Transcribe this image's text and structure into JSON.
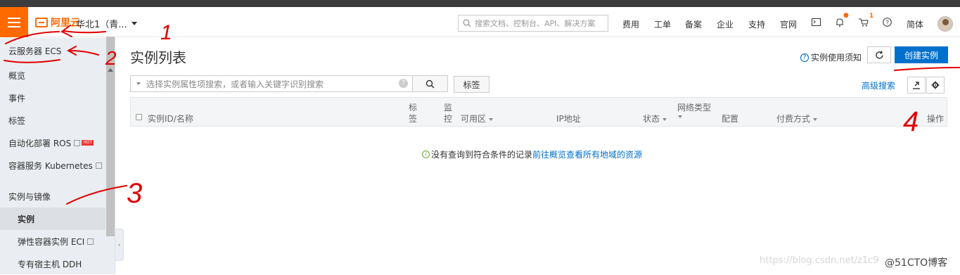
{
  "topbar": {
    "brand": "阿里云",
    "region": "华北1（青...",
    "search_placeholder": "搜索文档、控制台、API、解决方案",
    "nav": [
      "费用",
      "工单",
      "备案",
      "企业",
      "支持",
      "官网"
    ],
    "cart_count": "1",
    "language": "简体"
  },
  "sidebar": {
    "header": "云服务器 ECS",
    "items": [
      {
        "label": "概览"
      },
      {
        "label": "事件"
      },
      {
        "label": "标签"
      },
      {
        "label": "自动化部署 ROS",
        "badge": "HOT"
      },
      {
        "label": "容器服务 Kubernetes"
      }
    ],
    "group": "实例与镜像",
    "sub_items": [
      {
        "label": "实例"
      },
      {
        "label": "弹性容器实例 ECI"
      },
      {
        "label": "专有宿主机 DDH"
      }
    ]
  },
  "main": {
    "title": "实例列表",
    "help_link": "实例使用须知",
    "create_button": "创建实例",
    "filter_placeholder": "选择实例属性项搜索，或者输入关键字识别搜索",
    "tag_button": "标签",
    "advanced_search": "高级搜索",
    "columns": {
      "id": "实例ID/名称",
      "tag_1": "标",
      "tag_2": "签",
      "mon_1": "监",
      "mon_2": "控",
      "zone": "可用区",
      "ip": "IP地址",
      "status": "状态",
      "net": "网络类型",
      "config": "配置",
      "pay": "付费方式",
      "ops": "操作"
    },
    "empty_text": "没有查询到符合条件的记录",
    "empty_link": "前往概览查看所有地域的资源"
  },
  "annotations": [
    "1",
    "2",
    "3",
    "4"
  ],
  "watermark": {
    "url": "https://blog.csdn.net/z1c9",
    "brand": "@51CTO博客"
  },
  "colors": {
    "brand_orange": "#ff6a00",
    "primary_blue": "#0070cc",
    "annotation_red": "#e00000"
  }
}
